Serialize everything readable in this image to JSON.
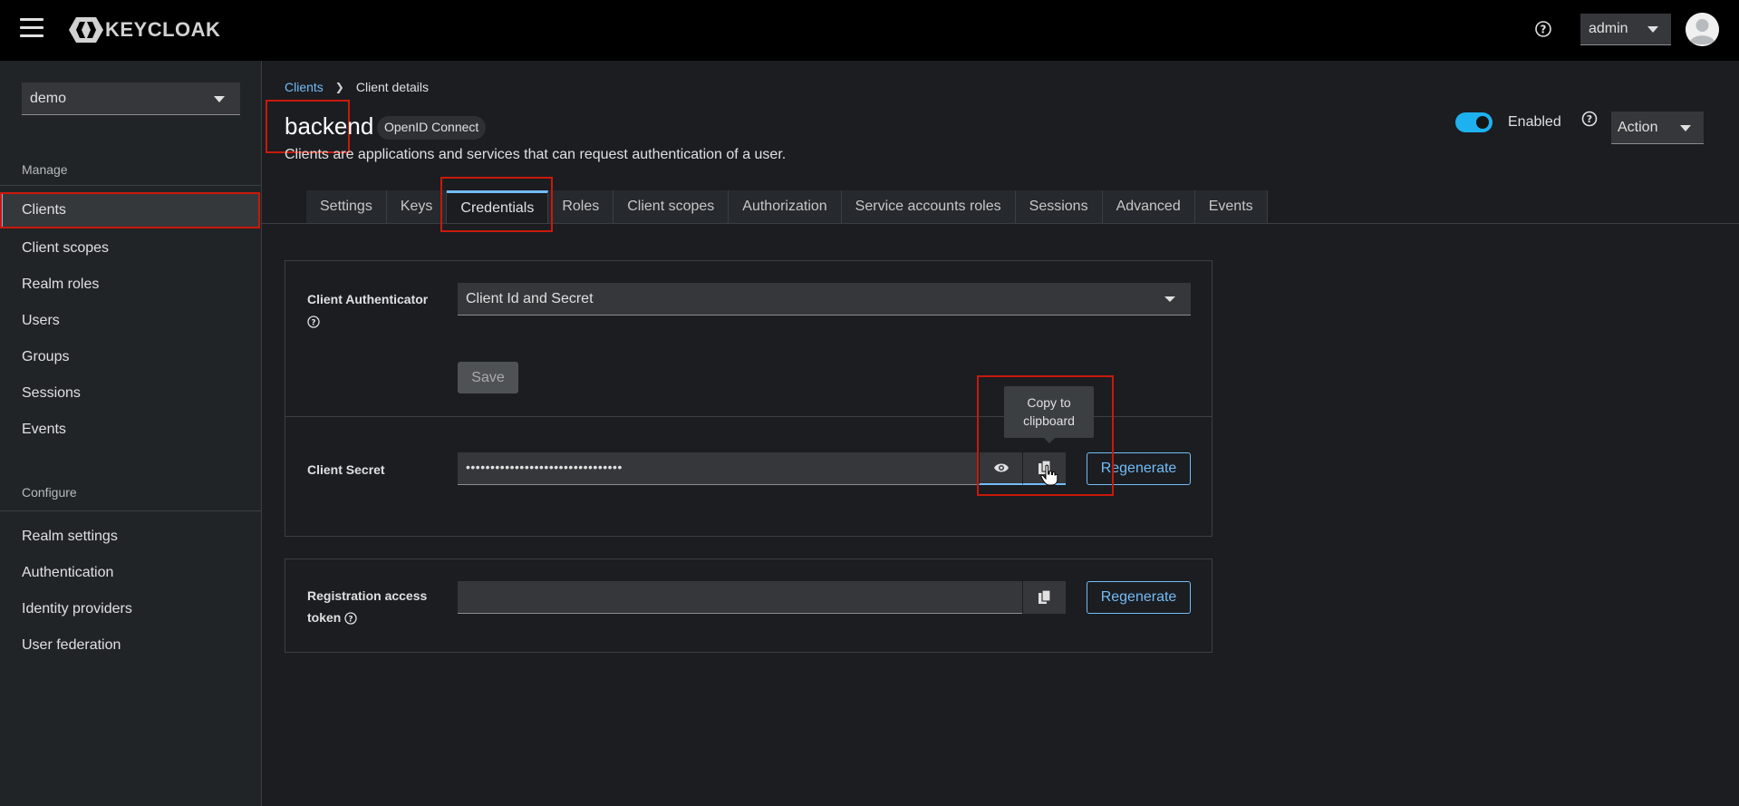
{
  "header": {
    "logo_text": "KEYCLOAK",
    "user_menu": "admin"
  },
  "sidebar": {
    "realm": "demo",
    "manage_label": "Manage",
    "manage_items": [
      {
        "label": "Clients"
      },
      {
        "label": "Client scopes"
      },
      {
        "label": "Realm roles"
      },
      {
        "label": "Users"
      },
      {
        "label": "Groups"
      },
      {
        "label": "Sessions"
      },
      {
        "label": "Events"
      }
    ],
    "configure_label": "Configure",
    "configure_items": [
      {
        "label": "Realm settings"
      },
      {
        "label": "Authentication"
      },
      {
        "label": "Identity providers"
      },
      {
        "label": "User federation"
      }
    ]
  },
  "breadcrumb": {
    "parent": "Clients",
    "current": "Client details"
  },
  "page": {
    "title": "backend",
    "protocol": "OpenID Connect",
    "description": "Clients are applications and services that can request authentication of a user.",
    "enabled_label": "Enabled",
    "action_label": "Action"
  },
  "tabs": [
    {
      "label": "Settings"
    },
    {
      "label": "Keys"
    },
    {
      "label": "Credentials"
    },
    {
      "label": "Roles"
    },
    {
      "label": "Client scopes"
    },
    {
      "label": "Authorization"
    },
    {
      "label": "Service accounts roles"
    },
    {
      "label": "Sessions"
    },
    {
      "label": "Advanced"
    },
    {
      "label": "Events"
    }
  ],
  "credentials": {
    "authenticator_label": "Client Authenticator",
    "authenticator_value": "Client Id and Secret",
    "save_label": "Save",
    "secret_label": "Client Secret",
    "secret_value": "••••••••••••••••••••••••••••••••",
    "tooltip": "Copy to clipboard",
    "regenerate_label": "Regenerate",
    "token_label": "Registration access token",
    "token_value": "",
    "token_regenerate_label": "Regenerate"
  },
  "colors": {
    "accent": "#73bcf7",
    "highlight": "#c9190b",
    "toggle_on": "#1eb1f0"
  }
}
